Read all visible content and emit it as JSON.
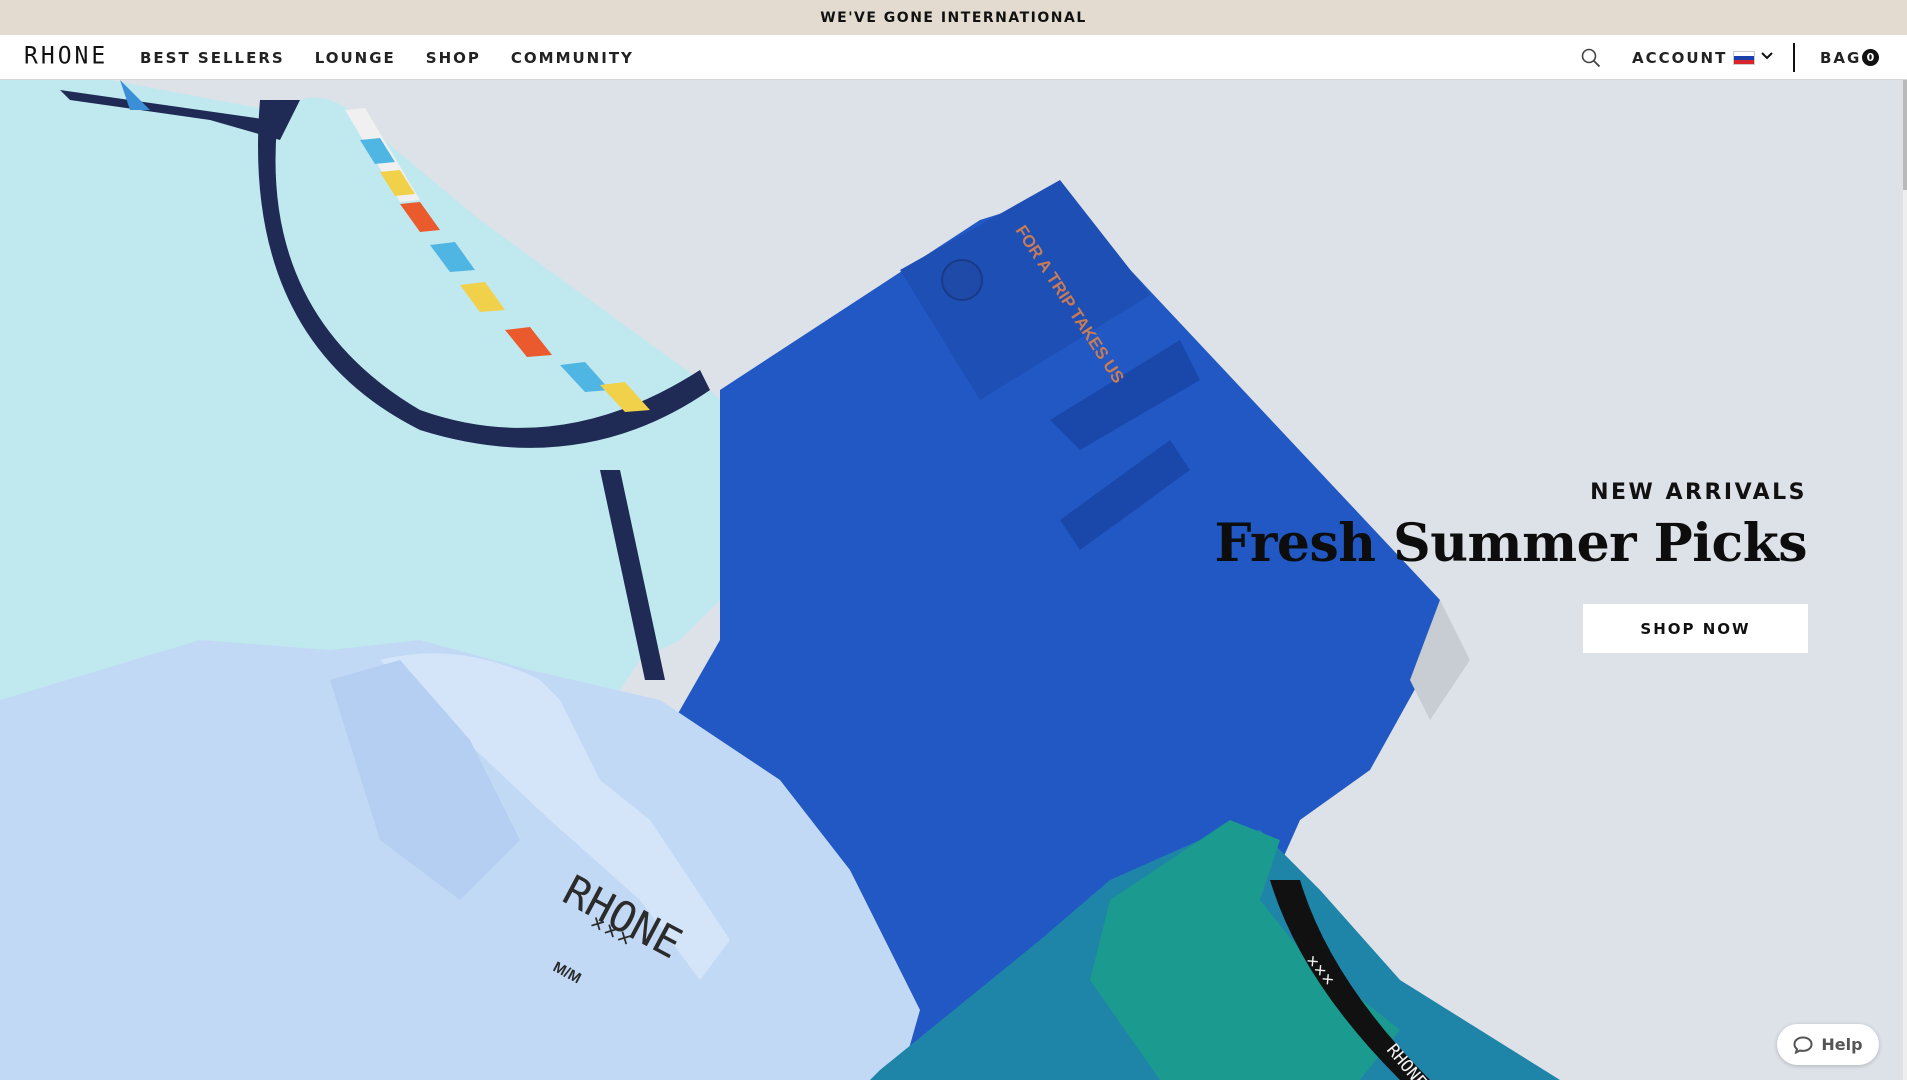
{
  "announcement": "WE'VE GONE INTERNATIONAL",
  "header": {
    "logo": "RHONE",
    "nav": [
      "BEST SELLERS",
      "LOUNGE",
      "SHOP",
      "COMMUNITY"
    ],
    "search_icon": "search-icon",
    "account_label": "ACCOUNT",
    "country_flag": "russia-flag-icon",
    "bag_label": "BAG",
    "bag_count": "0"
  },
  "hero": {
    "eyebrow": "NEW ARRIVALS",
    "headline": "Fresh Summer Picks",
    "cta_label": "SHOP NOW",
    "image_text": {
      "shorts_print": "FOR A TRIP TAKES US",
      "label_brand": "RHONE",
      "label_size": "M/M",
      "tee_neck_brand": "RHONE"
    }
  },
  "help_widget": {
    "label": "Help",
    "icon": "chat-bubble-icon"
  },
  "colors": {
    "announcement_bg": "#e3dbcf",
    "hero_bg": "#dde1e8",
    "text_dark": "#111111"
  }
}
